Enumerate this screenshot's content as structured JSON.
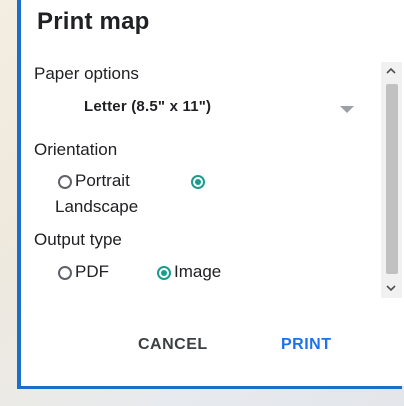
{
  "dialog": {
    "title": "Print map",
    "paper": {
      "label": "Paper options",
      "selected": "Letter (8.5\" x 11\")"
    },
    "orientation": {
      "label": "Orientation",
      "options": [
        {
          "label": "Portrait",
          "checked": false
        },
        {
          "label": "Landscape",
          "checked": true
        }
      ]
    },
    "output": {
      "label": "Output type",
      "options": [
        {
          "label": "PDF",
          "checked": false
        },
        {
          "label": "Image",
          "checked": true
        }
      ]
    },
    "actions": {
      "cancel": "CANCEL",
      "print": "PRINT"
    }
  },
  "colors": {
    "accent": "#1a73e8",
    "frame": "#1c6fc9",
    "radio_checked": "#1a9c8e"
  }
}
